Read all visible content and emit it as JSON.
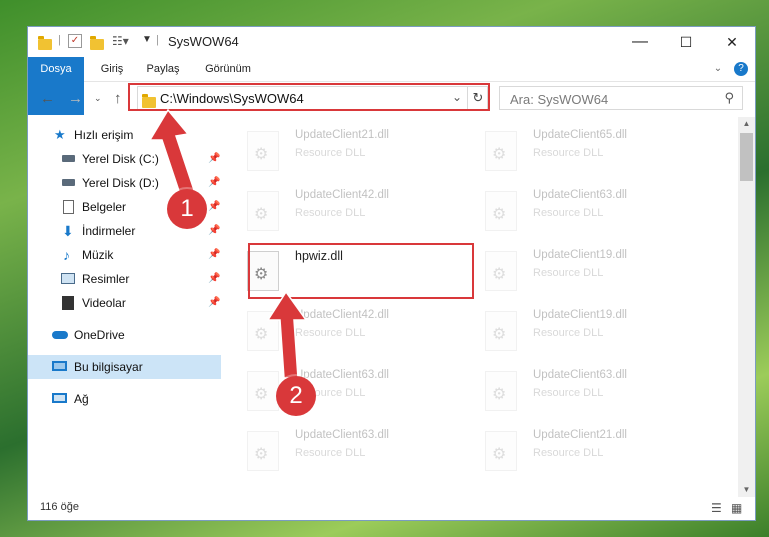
{
  "window": {
    "title": "SysWOW64",
    "minimize": "—",
    "maximize": "☐",
    "close": "✕"
  },
  "ribbon": {
    "tabs": [
      "Dosya",
      "Giriş",
      "Paylaş",
      "Görünüm"
    ]
  },
  "address": {
    "path": "C:\\Windows\\SysWOW64",
    "search_placeholder": "Ara: SysWOW64"
  },
  "nav": {
    "quick_access": "Hızlı erişim",
    "items": [
      {
        "label": "Yerel Disk (C:)",
        "icon": "drive-icon"
      },
      {
        "label": "Yerel Disk (D:)",
        "icon": "drive-icon"
      },
      {
        "label": "Belgeler",
        "icon": "documents-icon"
      },
      {
        "label": "İndirmeler",
        "icon": "downloads-icon"
      },
      {
        "label": "Müzik",
        "icon": "music-icon"
      },
      {
        "label": "Resimler",
        "icon": "pictures-icon"
      },
      {
        "label": "Videolar",
        "icon": "videos-icon"
      }
    ],
    "onedrive": "OneDrive",
    "this_pc": "Bu bilgisayar",
    "network": "Ağ"
  },
  "files": {
    "left": [
      {
        "name": "UpdateClient21.dll",
        "type": "Resource DLL"
      },
      {
        "name": "UpdateClient42.dll",
        "type": "Resource DLL"
      },
      {
        "name": "hpwiz.dll",
        "type": ""
      },
      {
        "name": "UpdateClient42.dll",
        "type": "Resource DLL"
      },
      {
        "name": "UpdateClient63.dll",
        "type": "Resource DLL"
      },
      {
        "name": "UpdateClient63.dll",
        "type": "Resource DLL"
      }
    ],
    "right": [
      {
        "name": "UpdateClient65.dll",
        "type": "Resource DLL"
      },
      {
        "name": "UpdateClient63.dll",
        "type": "Resource DLL"
      },
      {
        "name": "UpdateClient19.dll",
        "type": "Resource DLL"
      },
      {
        "name": "UpdateClient19.dll",
        "type": "Resource DLL"
      },
      {
        "name": "UpdateClient63.dll",
        "type": "Resource DLL"
      },
      {
        "name": "UpdateClient21.dll",
        "type": "Resource DLL"
      }
    ]
  },
  "status": {
    "count": "116 öğe"
  },
  "annotations": {
    "step1": "1",
    "step2": "2",
    "color": "#d9383a"
  }
}
